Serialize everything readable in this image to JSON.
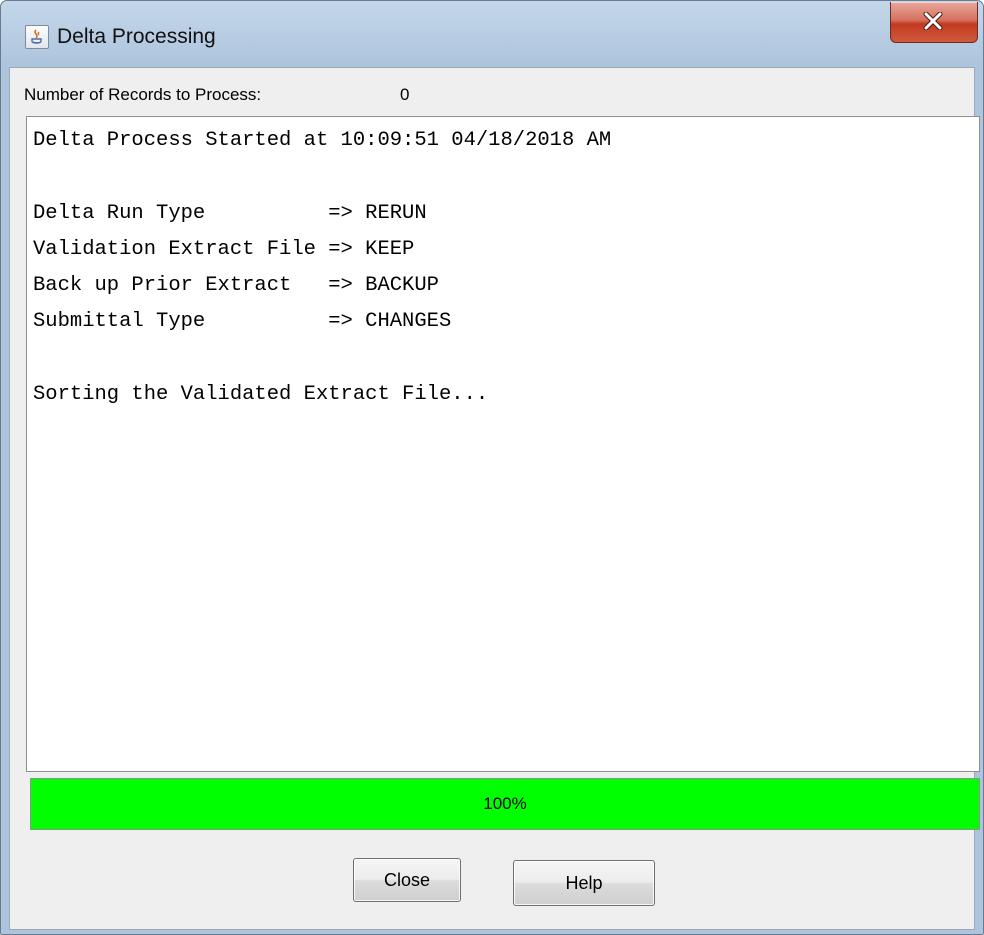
{
  "window": {
    "title": "Delta Processing",
    "app_icon": "java-icon",
    "close_icon": "close-x-icon"
  },
  "records": {
    "label": "Number of Records to Process:",
    "value": "0"
  },
  "log": {
    "lines": [
      "Delta Process Started at 10:09:51 04/18/2018 AM",
      "",
      "Delta Run Type          => RERUN",
      "Validation Extract File => KEEP",
      "Back up Prior Extract   => BACKUP",
      "Submittal Type          => CHANGES",
      "",
      "Sorting the Validated Extract File..."
    ]
  },
  "progress": {
    "fraction": 1.0,
    "label": "100%",
    "color": "#00ff00"
  },
  "buttons": {
    "close_label": "Close",
    "help_label": "Help"
  }
}
